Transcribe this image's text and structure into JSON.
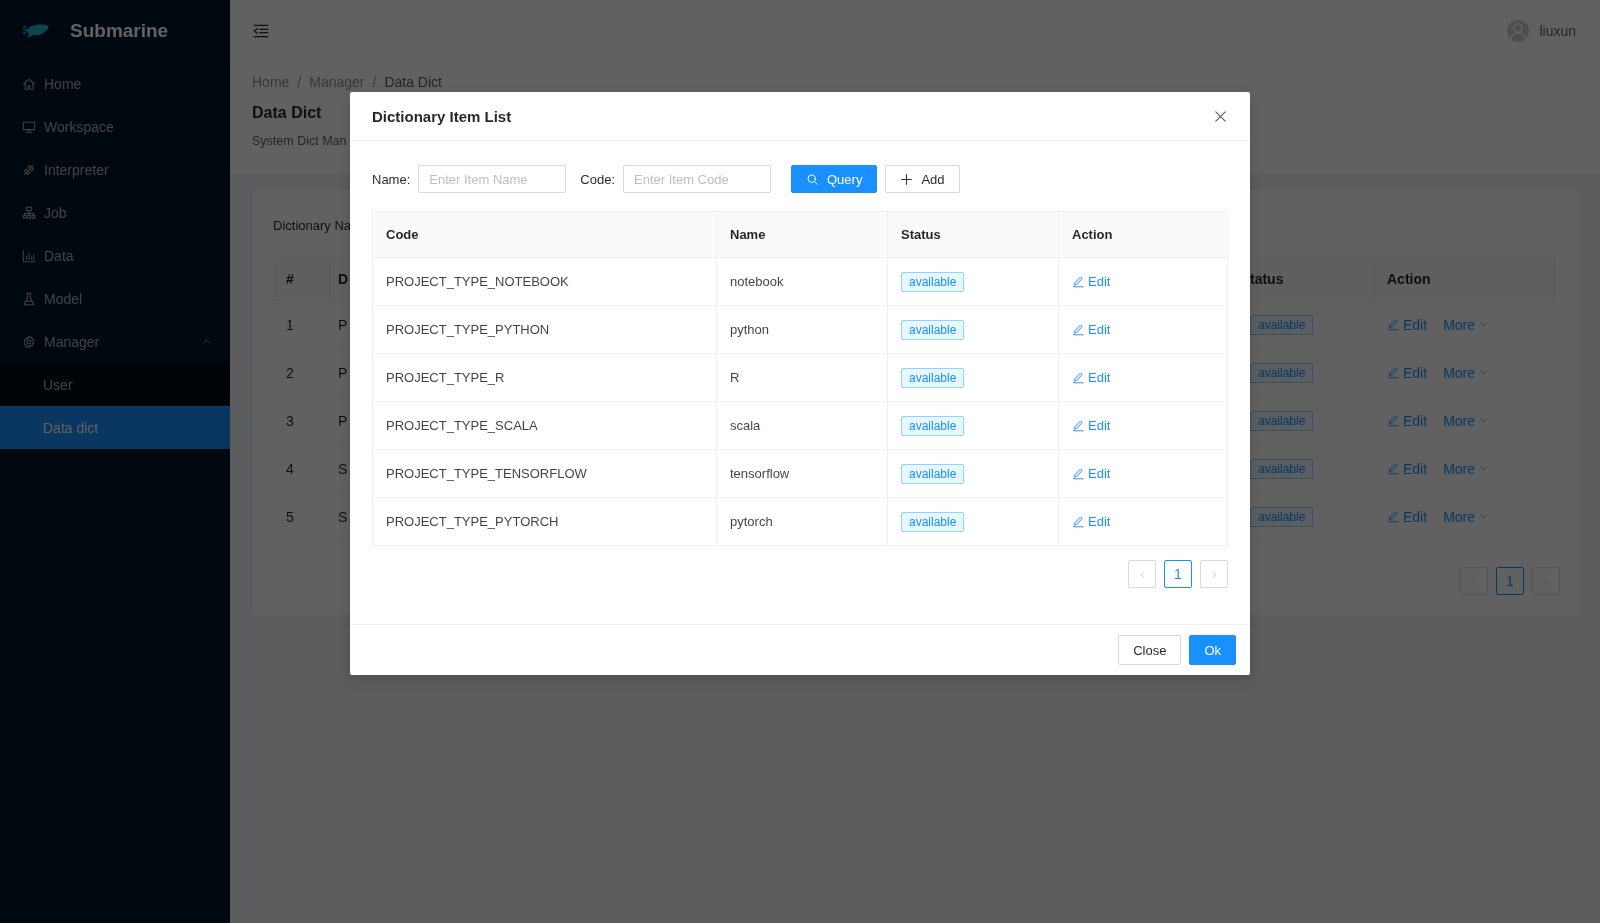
{
  "sidebar": {
    "app_title": "Submarine",
    "items": [
      {
        "label": "Home",
        "selected": false
      },
      {
        "label": "Workspace",
        "selected": false
      },
      {
        "label": "Interpreter",
        "selected": false
      },
      {
        "label": "Job",
        "selected": false
      },
      {
        "label": "Data",
        "selected": false
      },
      {
        "label": "Model",
        "selected": false
      },
      {
        "label": "Manager",
        "selected": false,
        "expanded": true,
        "children": [
          {
            "label": "User",
            "selected": false
          },
          {
            "label": "Data dict",
            "selected": true
          }
        ]
      }
    ]
  },
  "header": {
    "user": "liuxun"
  },
  "breadcrumb": {
    "separator": "/",
    "items": [
      "Home",
      "Manager",
      "Data Dict"
    ]
  },
  "page": {
    "title": "Data Dict",
    "description": "System Dict Man"
  },
  "card": {
    "filter_label": "Dictionary Na",
    "table": {
      "columns": [
        "#",
        "D",
        "tatus",
        "Action"
      ],
      "rows": [
        {
          "index": "1",
          "column_2": "P",
          "status": "available",
          "actions": [
            "Edit",
            "More"
          ]
        },
        {
          "index": "2",
          "column_2": "P",
          "status": "available",
          "actions": [
            "Edit",
            "More"
          ]
        },
        {
          "index": "3",
          "column_2": "P",
          "status": "available",
          "actions": [
            "Edit",
            "More"
          ]
        },
        {
          "index": "4",
          "column_2": "S",
          "status": "available",
          "actions": [
            "Edit",
            "More"
          ]
        },
        {
          "index": "5",
          "column_2": "S",
          "status": "available",
          "actions": [
            "Edit",
            "More"
          ]
        }
      ]
    },
    "pagination": {
      "pages": [
        {
          "label": "1",
          "selected": true
        }
      ]
    }
  },
  "modal": {
    "title": "Dictionary Item List",
    "filters": [
      {
        "label": "Name:",
        "placeholder": "Enter Item Name"
      },
      {
        "label": "Code:",
        "placeholder": "Enter Item Code"
      }
    ],
    "buttons": [
      {
        "label": "Query",
        "kind": "primary"
      },
      {
        "label": "Add",
        "kind": "default"
      }
    ],
    "table": {
      "columns": [
        "Code",
        "Name",
        "Status",
        "Action"
      ],
      "rows": [
        {
          "code": "PROJECT_TYPE_NOTEBOOK",
          "name": "notebook",
          "status": "available",
          "action": "Edit"
        },
        {
          "code": "PROJECT_TYPE_PYTHON",
          "name": "python",
          "status": "available",
          "action": "Edit"
        },
        {
          "code": "PROJECT_TYPE_R",
          "name": "R",
          "status": "available",
          "action": "Edit"
        },
        {
          "code": "PROJECT_TYPE_SCALA",
          "name": "scala",
          "status": "available",
          "action": "Edit"
        },
        {
          "code": "PROJECT_TYPE_TENSORFLOW",
          "name": "tensorflow",
          "status": "available",
          "action": "Edit"
        },
        {
          "code": "PROJECT_TYPE_PYTORCH",
          "name": "pytorch",
          "status": "available",
          "action": "Edit"
        }
      ]
    },
    "pagination": {
      "pages": [
        {
          "label": "1",
          "selected": true
        }
      ]
    },
    "footer_buttons": [
      {
        "label": "Close",
        "kind": "default"
      },
      {
        "label": "Ok",
        "kind": "primary"
      }
    ]
  }
}
